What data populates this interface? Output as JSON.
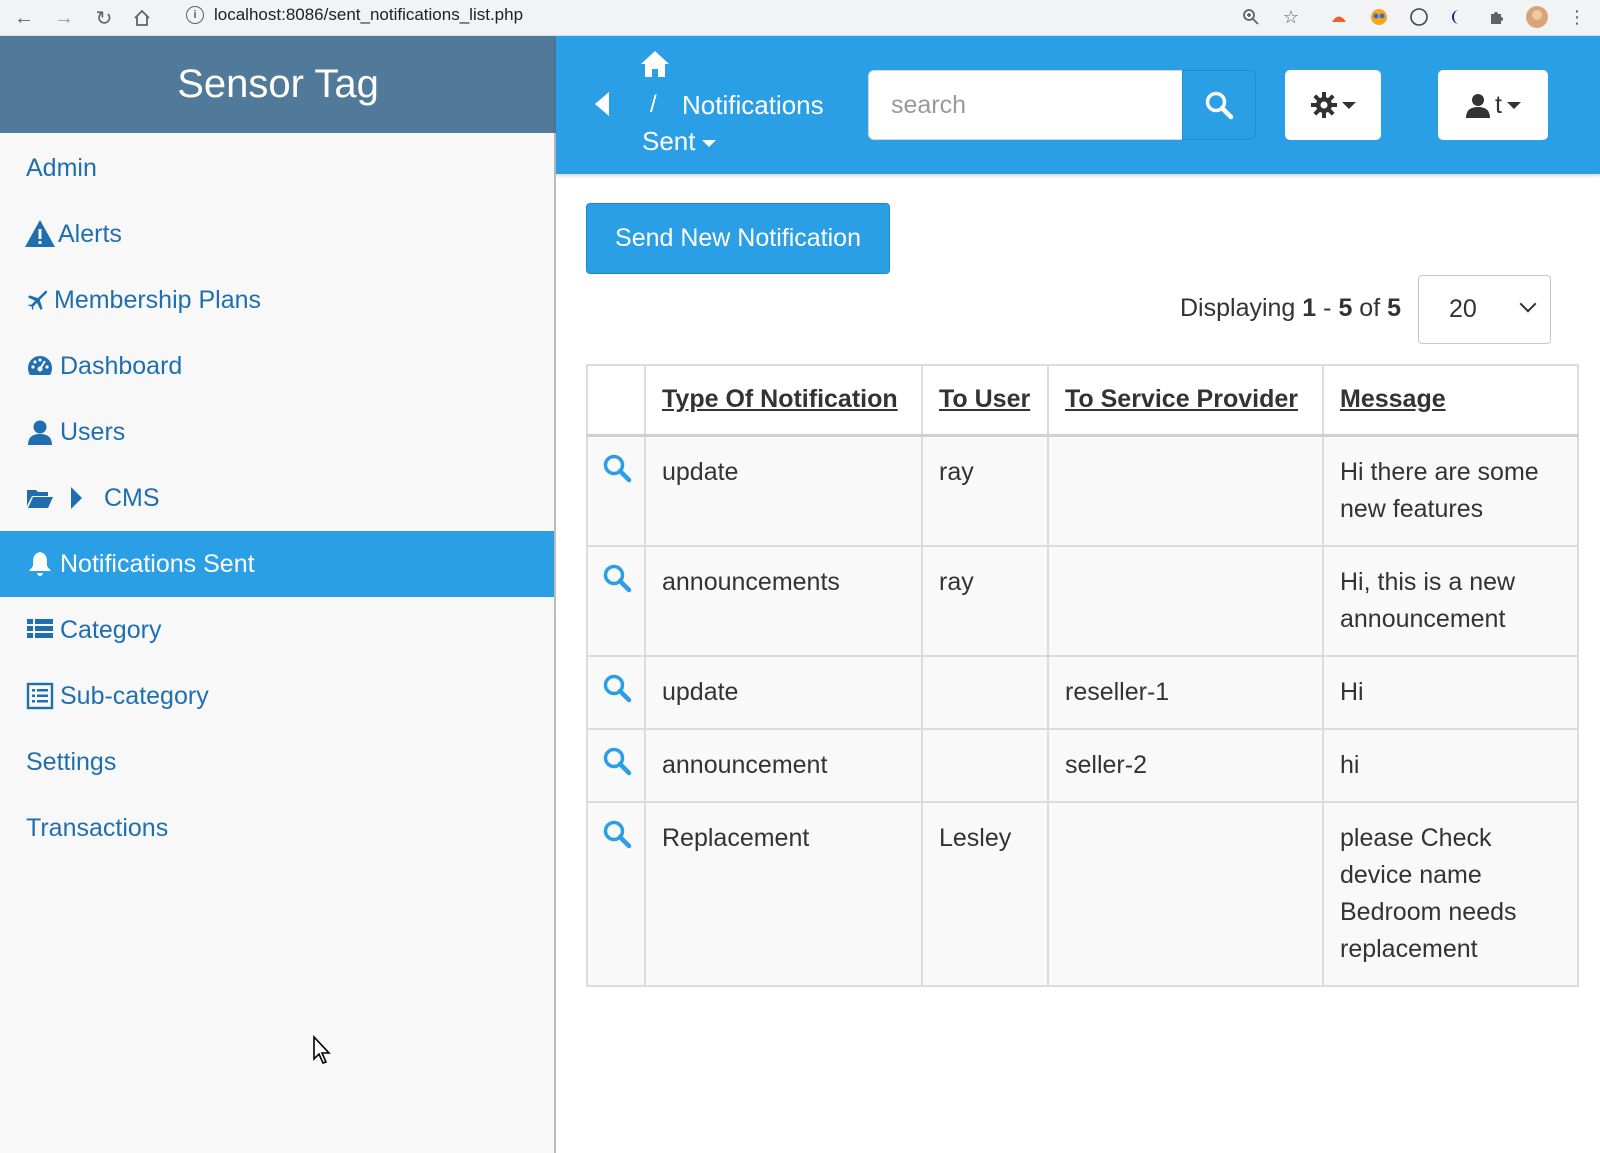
{
  "browser": {
    "url": "localhost:8086/sent_notifications_list.php"
  },
  "sidebar": {
    "brand": "Sensor Tag",
    "items": [
      {
        "label": "Admin",
        "icon": "none"
      },
      {
        "label": "Alerts",
        "icon": "warning-icon"
      },
      {
        "label": "Membership Plans",
        "icon": "plane-icon"
      },
      {
        "label": "Dashboard",
        "icon": "dashboard-icon"
      },
      {
        "label": "Users",
        "icon": "user-icon"
      },
      {
        "label": "CMS",
        "icon": "folder-open-icon"
      },
      {
        "label": "Notifications Sent",
        "icon": "bell-icon",
        "active": true
      },
      {
        "label": "Category",
        "icon": "list-icon"
      },
      {
        "label": "Sub-category",
        "icon": "list-alt-icon"
      },
      {
        "label": "Settings",
        "icon": "none"
      },
      {
        "label": "Transactions",
        "icon": "none"
      }
    ]
  },
  "header": {
    "breadcrumb_separator": "/",
    "breadcrumb_title": "Notifications",
    "breadcrumb_sub": "Sent",
    "search_placeholder": "search",
    "user_initial": "t"
  },
  "main": {
    "send_button_label": "Send New Notification",
    "displaying_prefix": "Displaying",
    "range_start": "1",
    "range_sep": "-",
    "range_end": "5",
    "of_label": "of",
    "total": "5",
    "page_size": "20",
    "table": {
      "columns": [
        "Type Of Notification",
        "To User",
        "To Service Provider",
        "Message"
      ],
      "rows": [
        {
          "type": "update",
          "to_user": "ray",
          "to_provider": "",
          "message": "Hi there are some new features"
        },
        {
          "type": "announcements",
          "to_user": "ray",
          "to_provider": "",
          "message": "Hi, this is a new announcement"
        },
        {
          "type": "update",
          "to_user": "",
          "to_provider": "reseller-1",
          "message": "Hi"
        },
        {
          "type": "announcement",
          "to_user": "",
          "to_provider": "seller-2",
          "message": "hi"
        },
        {
          "type": "Replacement",
          "to_user": "Lesley",
          "to_provider": "",
          "message": "please Check device name Bedroom needs replacement"
        }
      ]
    }
  },
  "colors": {
    "primary": "#2b9fe5",
    "brand_bg": "#517999",
    "sidebar_text": "#1f6fb0"
  }
}
